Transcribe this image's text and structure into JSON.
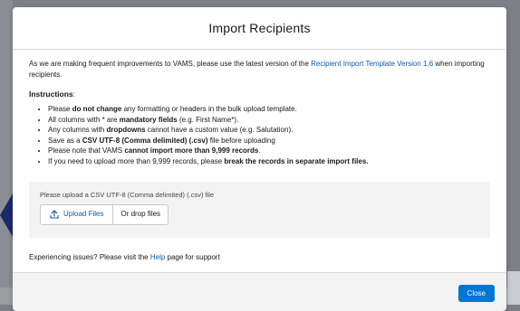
{
  "modal": {
    "title": "Import Recipients",
    "intro_before": "As we are making frequent improvements to VAMS, please use the latest version of the ",
    "intro_link": "Recipient Import Template Version 1.6",
    "intro_after": " when importing recipients.",
    "instructions_heading": "Instructions",
    "instructions_colon": ":",
    "instructions": [
      {
        "pre": "Please ",
        "bold": "do not change",
        "post": " any formatting or headers in the bulk upload template."
      },
      {
        "pre": "All columns with * are ",
        "bold": "mandatory fields",
        "post": " (e.g. First Name*)."
      },
      {
        "pre": "Any columns with ",
        "bold": "dropdowns",
        "post": " cannot have a custom value (e.g. Salutation)."
      },
      {
        "pre": "Save as a ",
        "bold": "CSV UTF-8 (Comma delimited) (.csv)",
        "post": " file before uploading"
      },
      {
        "pre": "Please note that VAMS ",
        "bold": "cannot import more than 9,999 records",
        "post": "."
      },
      {
        "pre": "If you need to upload more than 9,999 records, please ",
        "bold": "break the records in separate import files.",
        "post": ""
      }
    ],
    "upload": {
      "label": "Please upload a CSV UTF-8 (Comma delimited) (.csv) file",
      "button_label": "Upload Files",
      "drop_label": "Or drop files",
      "icon": "upload-icon"
    },
    "support_before": "Experiencing issues? Please visit the ",
    "support_link": "Help",
    "support_after": " page for support",
    "close_label": "Close"
  },
  "colors": {
    "brand": "#0176d3",
    "link": "#0b5cab",
    "backdrop": "#7d8187"
  }
}
